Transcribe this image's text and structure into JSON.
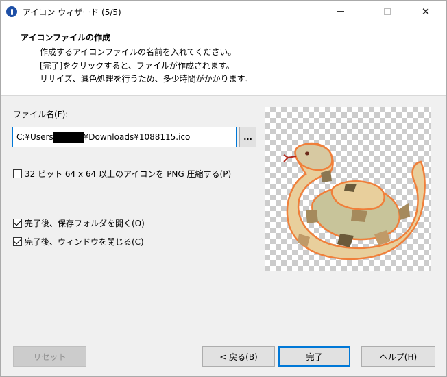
{
  "window": {
    "title": "アイコン ウィザード (5/5)"
  },
  "header": {
    "title": "アイコンファイルの作成",
    "line1": "作成するアイコンファイルの名前を入れてください。",
    "line2": "[完了]をクリックすると、ファイルが作成されます。",
    "line3": "リサイズ、減色処理を行うため、多少時間がかかります。"
  },
  "form": {
    "filename_label": "ファイル名(F):",
    "filename_prefix": "C:¥Users",
    "filename_suffix": "¥Downloads¥1088115.ico",
    "browse_label": "...",
    "png_compress_label": "32 ビット 64 x 64 以上のアイコンを PNG 圧縮する(P)",
    "png_compress_checked": false,
    "open_folder_label": "完了後、保存フォルダを開く(O)",
    "open_folder_checked": true,
    "close_window_label": "完了後、ウィンドウを閉じる(C)",
    "close_window_checked": true
  },
  "preview": {
    "icon": "snake-icon"
  },
  "footer": {
    "reset_label": "リセット",
    "back_label": "< 戻る(B)",
    "finish_label": "完了",
    "help_label": "ヘルプ(H)"
  },
  "colors": {
    "accent": "#0078d7",
    "snake_outline": "#f07f3a",
    "snake_light": "#e8cf9c",
    "snake_green": "#c8c49a",
    "snake_dark": "#6b5a3a"
  }
}
